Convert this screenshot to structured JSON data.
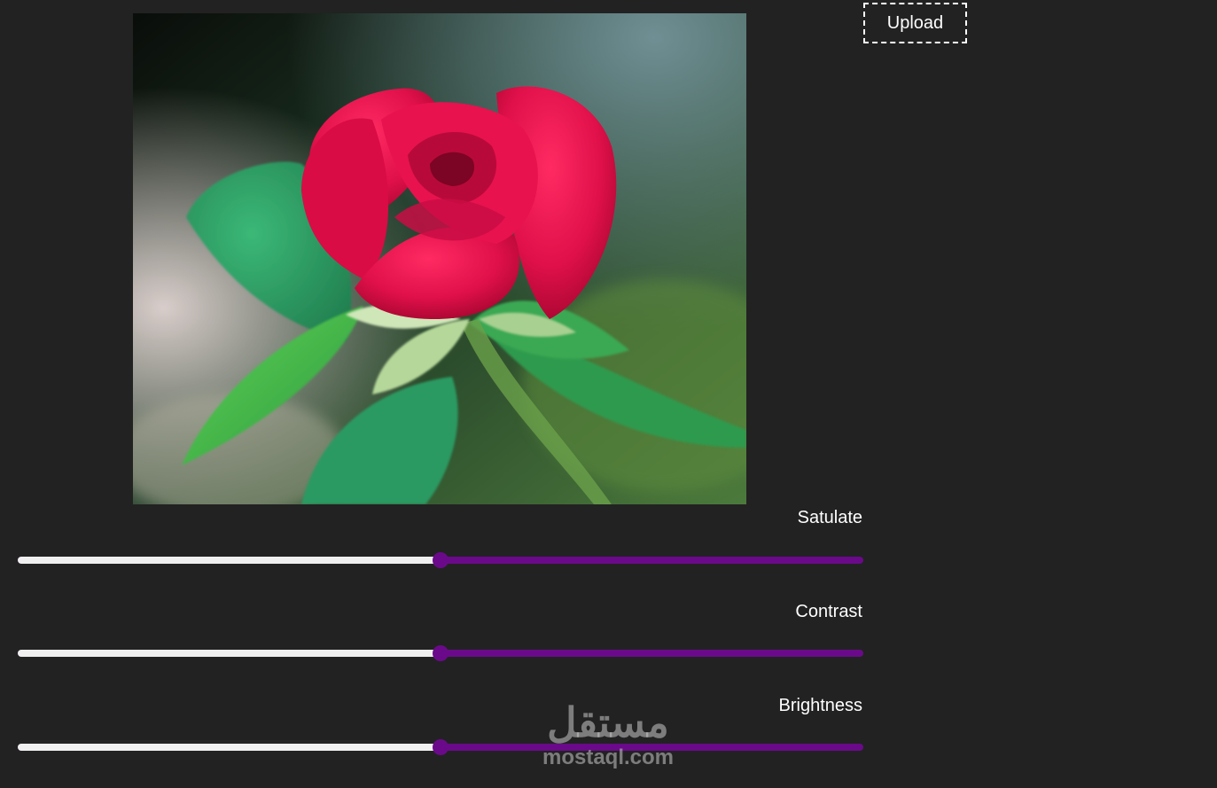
{
  "upload": {
    "label": "Upload"
  },
  "photo": {
    "subject": "red-rose-image"
  },
  "controls": [
    {
      "label": "Satulate",
      "value": 0.5
    },
    {
      "label": "Contrast",
      "value": 0.5
    },
    {
      "label": "Brightness",
      "value": 0.5
    }
  ],
  "colors": {
    "background": "#222222",
    "slider_accent": "#6a0a8a",
    "slider_track_light": "#f0f0f0"
  },
  "watermark": {
    "arabic": "مستقل",
    "latin": "mostaql.com"
  }
}
